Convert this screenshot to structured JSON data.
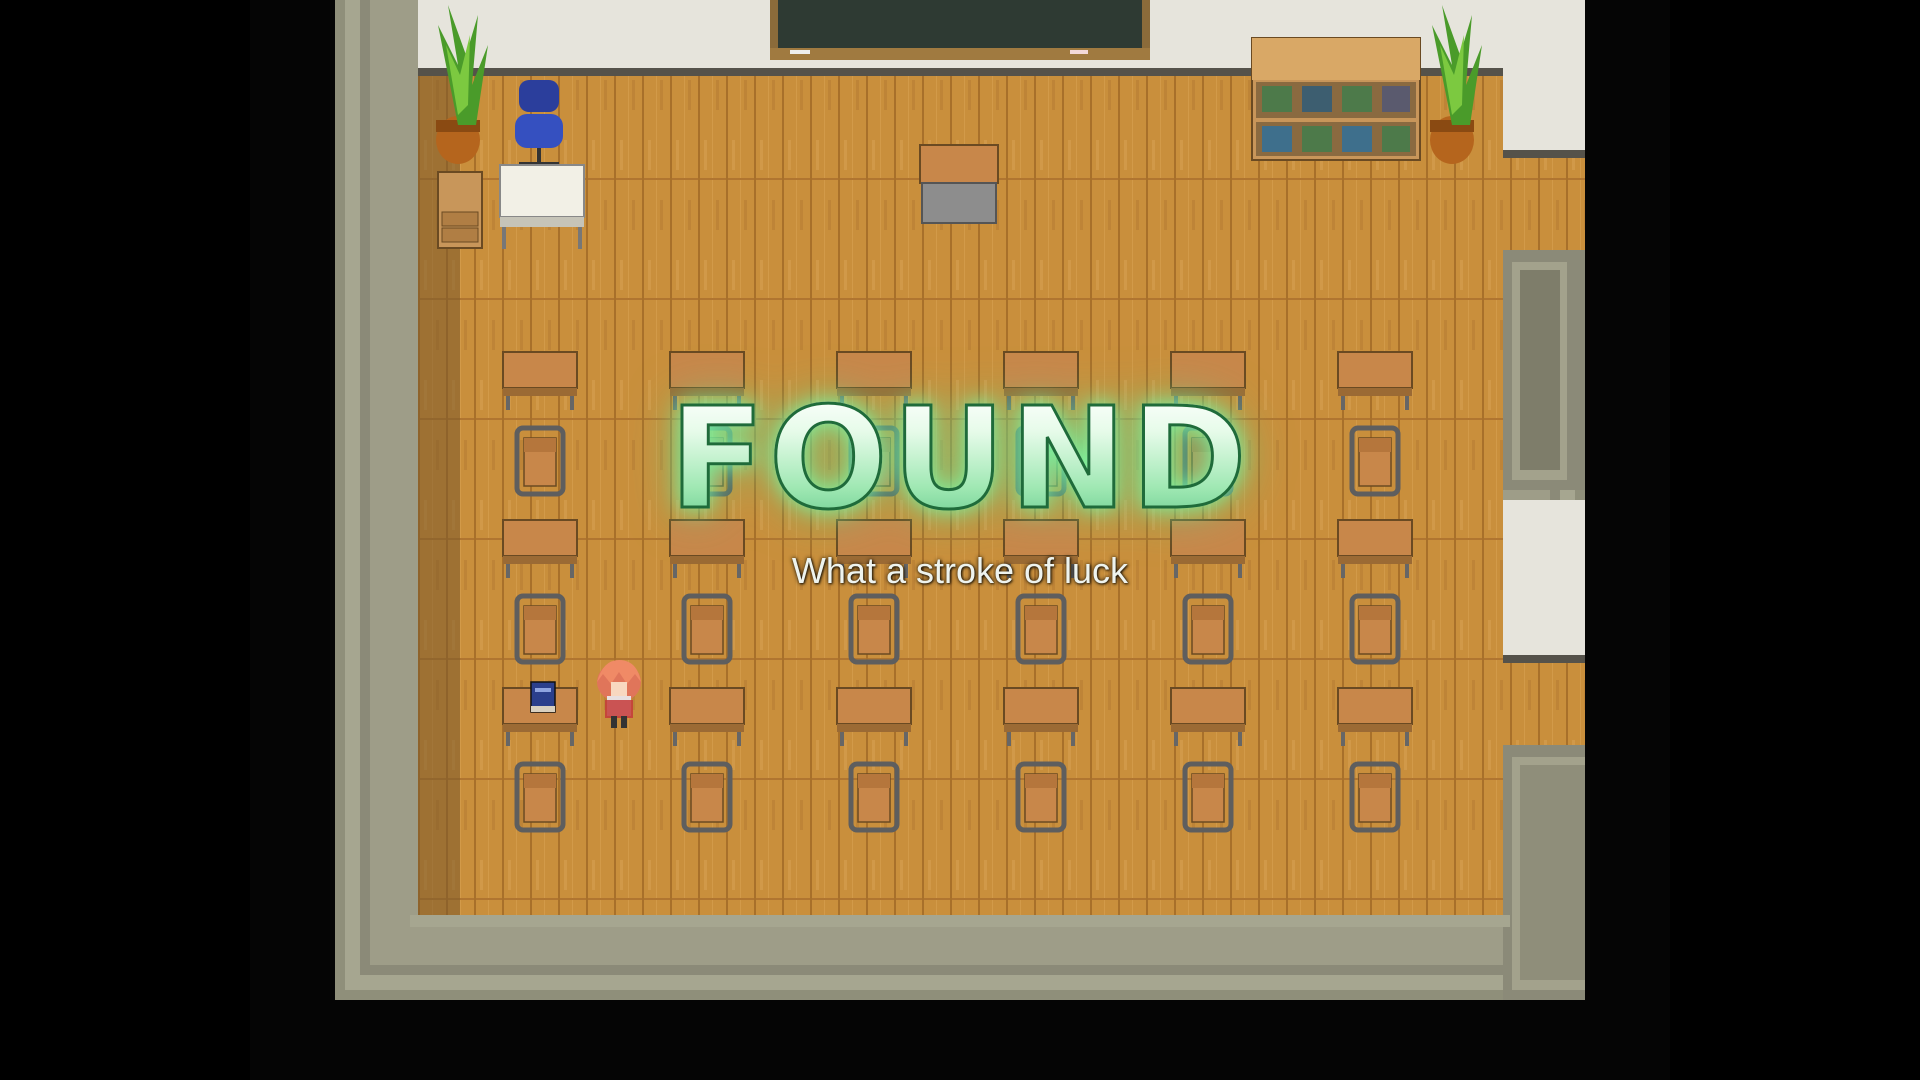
{
  "scene": {
    "name": "classroom",
    "colors": {
      "floor": "#c98f3c",
      "floor_dark": "#b57a2c",
      "wall": "#8b8a78",
      "wall_light": "#e8e6df",
      "void": "#000000",
      "blackboard": "#2e3a33",
      "desk": "#c8874a",
      "chair_frame": "#6b6b6b",
      "text_glow": "#7cf0a4"
    },
    "icons": [
      "plant-icon",
      "office-chair-icon",
      "nightstand-icon",
      "teacher-desk-icon",
      "podium-icon",
      "bookshelf-icon",
      "blackboard-icon",
      "school-desk-icon",
      "school-chair-icon",
      "book-icon",
      "player-character-icon"
    ],
    "layout": {
      "desk_columns": 6,
      "desk_rows": 3
    }
  },
  "overlay": {
    "title": "FOUND",
    "subtitle": "What a stroke of luck"
  }
}
